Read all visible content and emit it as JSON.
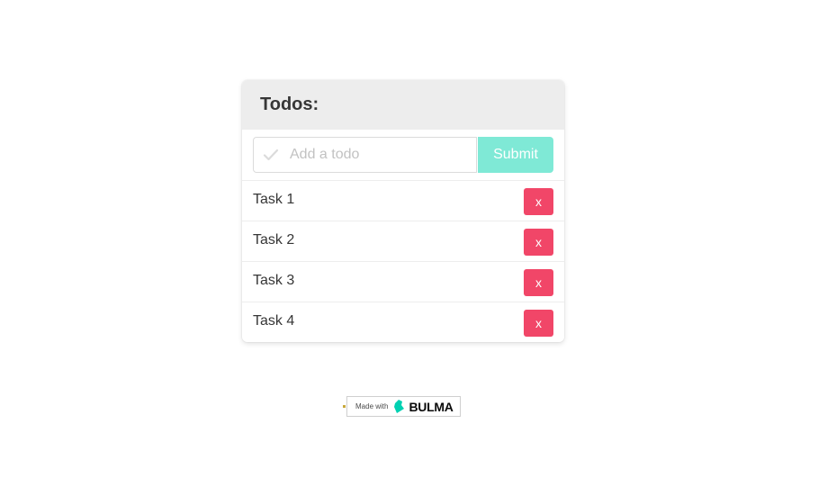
{
  "panel": {
    "title": "Todos:"
  },
  "form": {
    "input_placeholder": "Add a todo",
    "input_value": "",
    "submit_label": "Submit",
    "check_icon": "check-icon"
  },
  "tasks": [
    {
      "label": "Task 1",
      "delete_label": "x"
    },
    {
      "label": "Task 2",
      "delete_label": "x"
    },
    {
      "label": "Task 3",
      "delete_label": "x"
    },
    {
      "label": "Task 4",
      "delete_label": "x"
    }
  ],
  "footer": {
    "badge_made_with": "Made with",
    "badge_brand": "BULMA"
  },
  "colors": {
    "heading_bg": "#ededed",
    "submit_bg": "#7fe9d6",
    "delete_bg": "#f14668",
    "bulma_brand": "#00d1b2"
  }
}
